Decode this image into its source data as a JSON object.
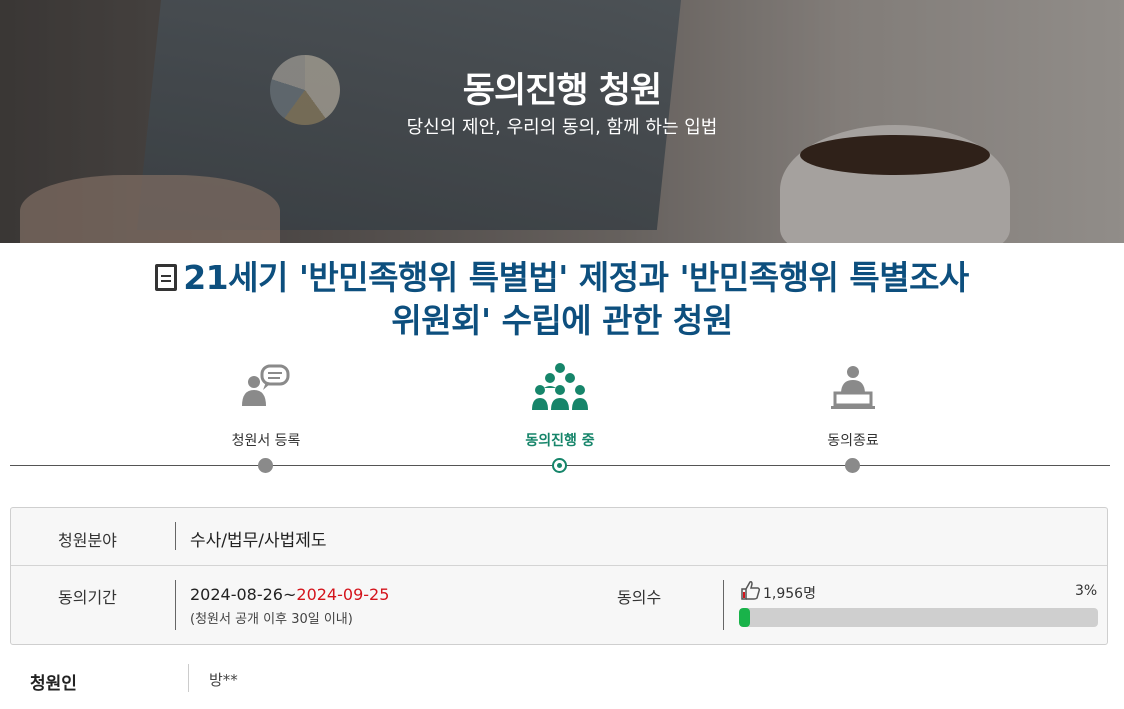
{
  "hero": {
    "title": "동의진행 청원",
    "subtitle": "당신의 제안, 우리의 동의, 함께 하는 입법"
  },
  "petition": {
    "title_line1": "21세기 '반민족행위 특별법' 제정과 '반민족행위 특별조사",
    "title_line2": "위원회' 수립에 관한 청원"
  },
  "steps": [
    {
      "label": "청원서 등록",
      "icon": "speaker-bubble-icon",
      "active": false
    },
    {
      "label": "동의진행 중",
      "icon": "group-icon",
      "active": true
    },
    {
      "label": "동의종료",
      "icon": "podium-icon",
      "active": false
    }
  ],
  "info": {
    "field_label": "청원분야",
    "field_value": "수사/법무/사법제도",
    "period_label": "동의기간",
    "period_start": "2024-08-26~",
    "period_end": "2024-09-25",
    "period_note": "(청원서 공개 이후 30일 이내)",
    "count_label": "동의수",
    "count_value": "1,956명",
    "percent_text": "3%",
    "progress_fraction": 0.03
  },
  "petitioner": {
    "label": "청원인",
    "value": "방**"
  },
  "colors": {
    "title_blue": "#0d4f7e",
    "active_green": "#16856a",
    "progress_green": "#19b34a",
    "deadline_red": "#d4141c"
  }
}
